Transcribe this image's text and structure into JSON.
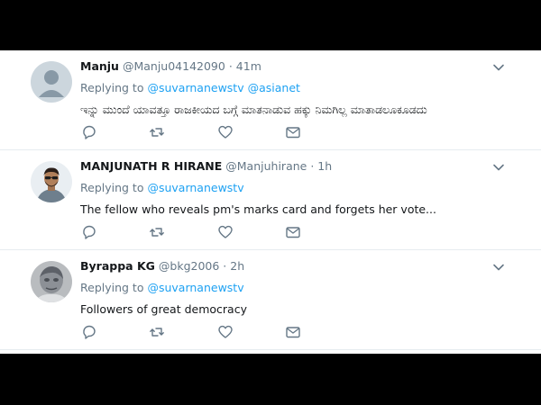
{
  "tweets": [
    {
      "name": "Manju",
      "handle": "@Manju04142090",
      "separator": "·",
      "time": "41m",
      "replying_label": "Replying to",
      "mentions": [
        "@suvarnanewstv",
        "@asianet"
      ],
      "text": "ಇನ್ನು ಮುಂದೆ ಯಾವತ್ತೂ ರಾಜಕೀಯದ ಬಗ್ಗೆ ಮಾತನಾಡುವ ಹಕ್ಕು ನಿಮಗಿಲ್ಲ ಮಾತಾಡಲೂಕೂಡದು"
    },
    {
      "name": "MANJUNATH R HIRANE",
      "handle": "@Manjuhirane",
      "separator": "·",
      "time": "1h",
      "replying_label": "Replying to",
      "mentions": [
        "@suvarnanewstv"
      ],
      "text": "The fellow who reveals pm's marks card and forgets her vote..."
    },
    {
      "name": "Byrappa KG",
      "handle": "@bkg2006",
      "separator": "·",
      "time": "2h",
      "replying_label": "Replying to",
      "mentions": [
        "@suvarnanewstv"
      ],
      "text": "Followers of great democracy"
    }
  ],
  "icons": {
    "reply": "reply-icon",
    "retweet": "retweet-icon",
    "like": "heart-icon",
    "message": "envelope-icon",
    "more": "chevron-down-icon"
  },
  "colors": {
    "link": "#1da1f2",
    "muted": "#657786",
    "text": "#14171a",
    "frame_background": "#000000"
  }
}
